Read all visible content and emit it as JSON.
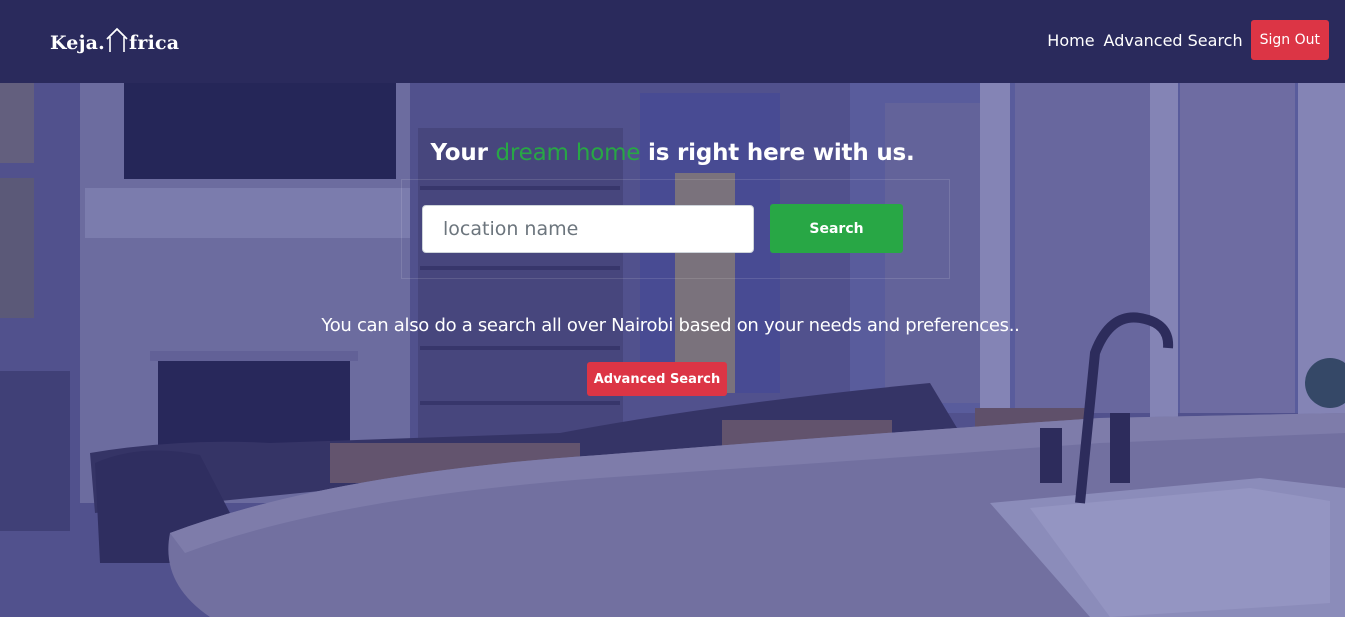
{
  "brand": {
    "logo_text_left": "Keja.",
    "logo_text_right": "frica",
    "logo_icon": "house-icon"
  },
  "nav": {
    "home": "Home",
    "advanced_search": "Advanced Search",
    "sign_out": "Sign Out"
  },
  "hero": {
    "headline_before": "Your ",
    "headline_accent": "dream home",
    "headline_after": " is right here with us.",
    "search_placeholder": "location name",
    "search_value": "",
    "search_button": "Search",
    "subtext": "You can also do a search all over Nairobi based on your needs and preferences..",
    "advanced_button": "Advanced Search",
    "background_image": "living-room-kitchen-photo"
  },
  "colors": {
    "navbar": "#2a2a5c",
    "accent_green": "#28a745",
    "accent_red": "#dc3545",
    "overlay": "#30328c"
  }
}
